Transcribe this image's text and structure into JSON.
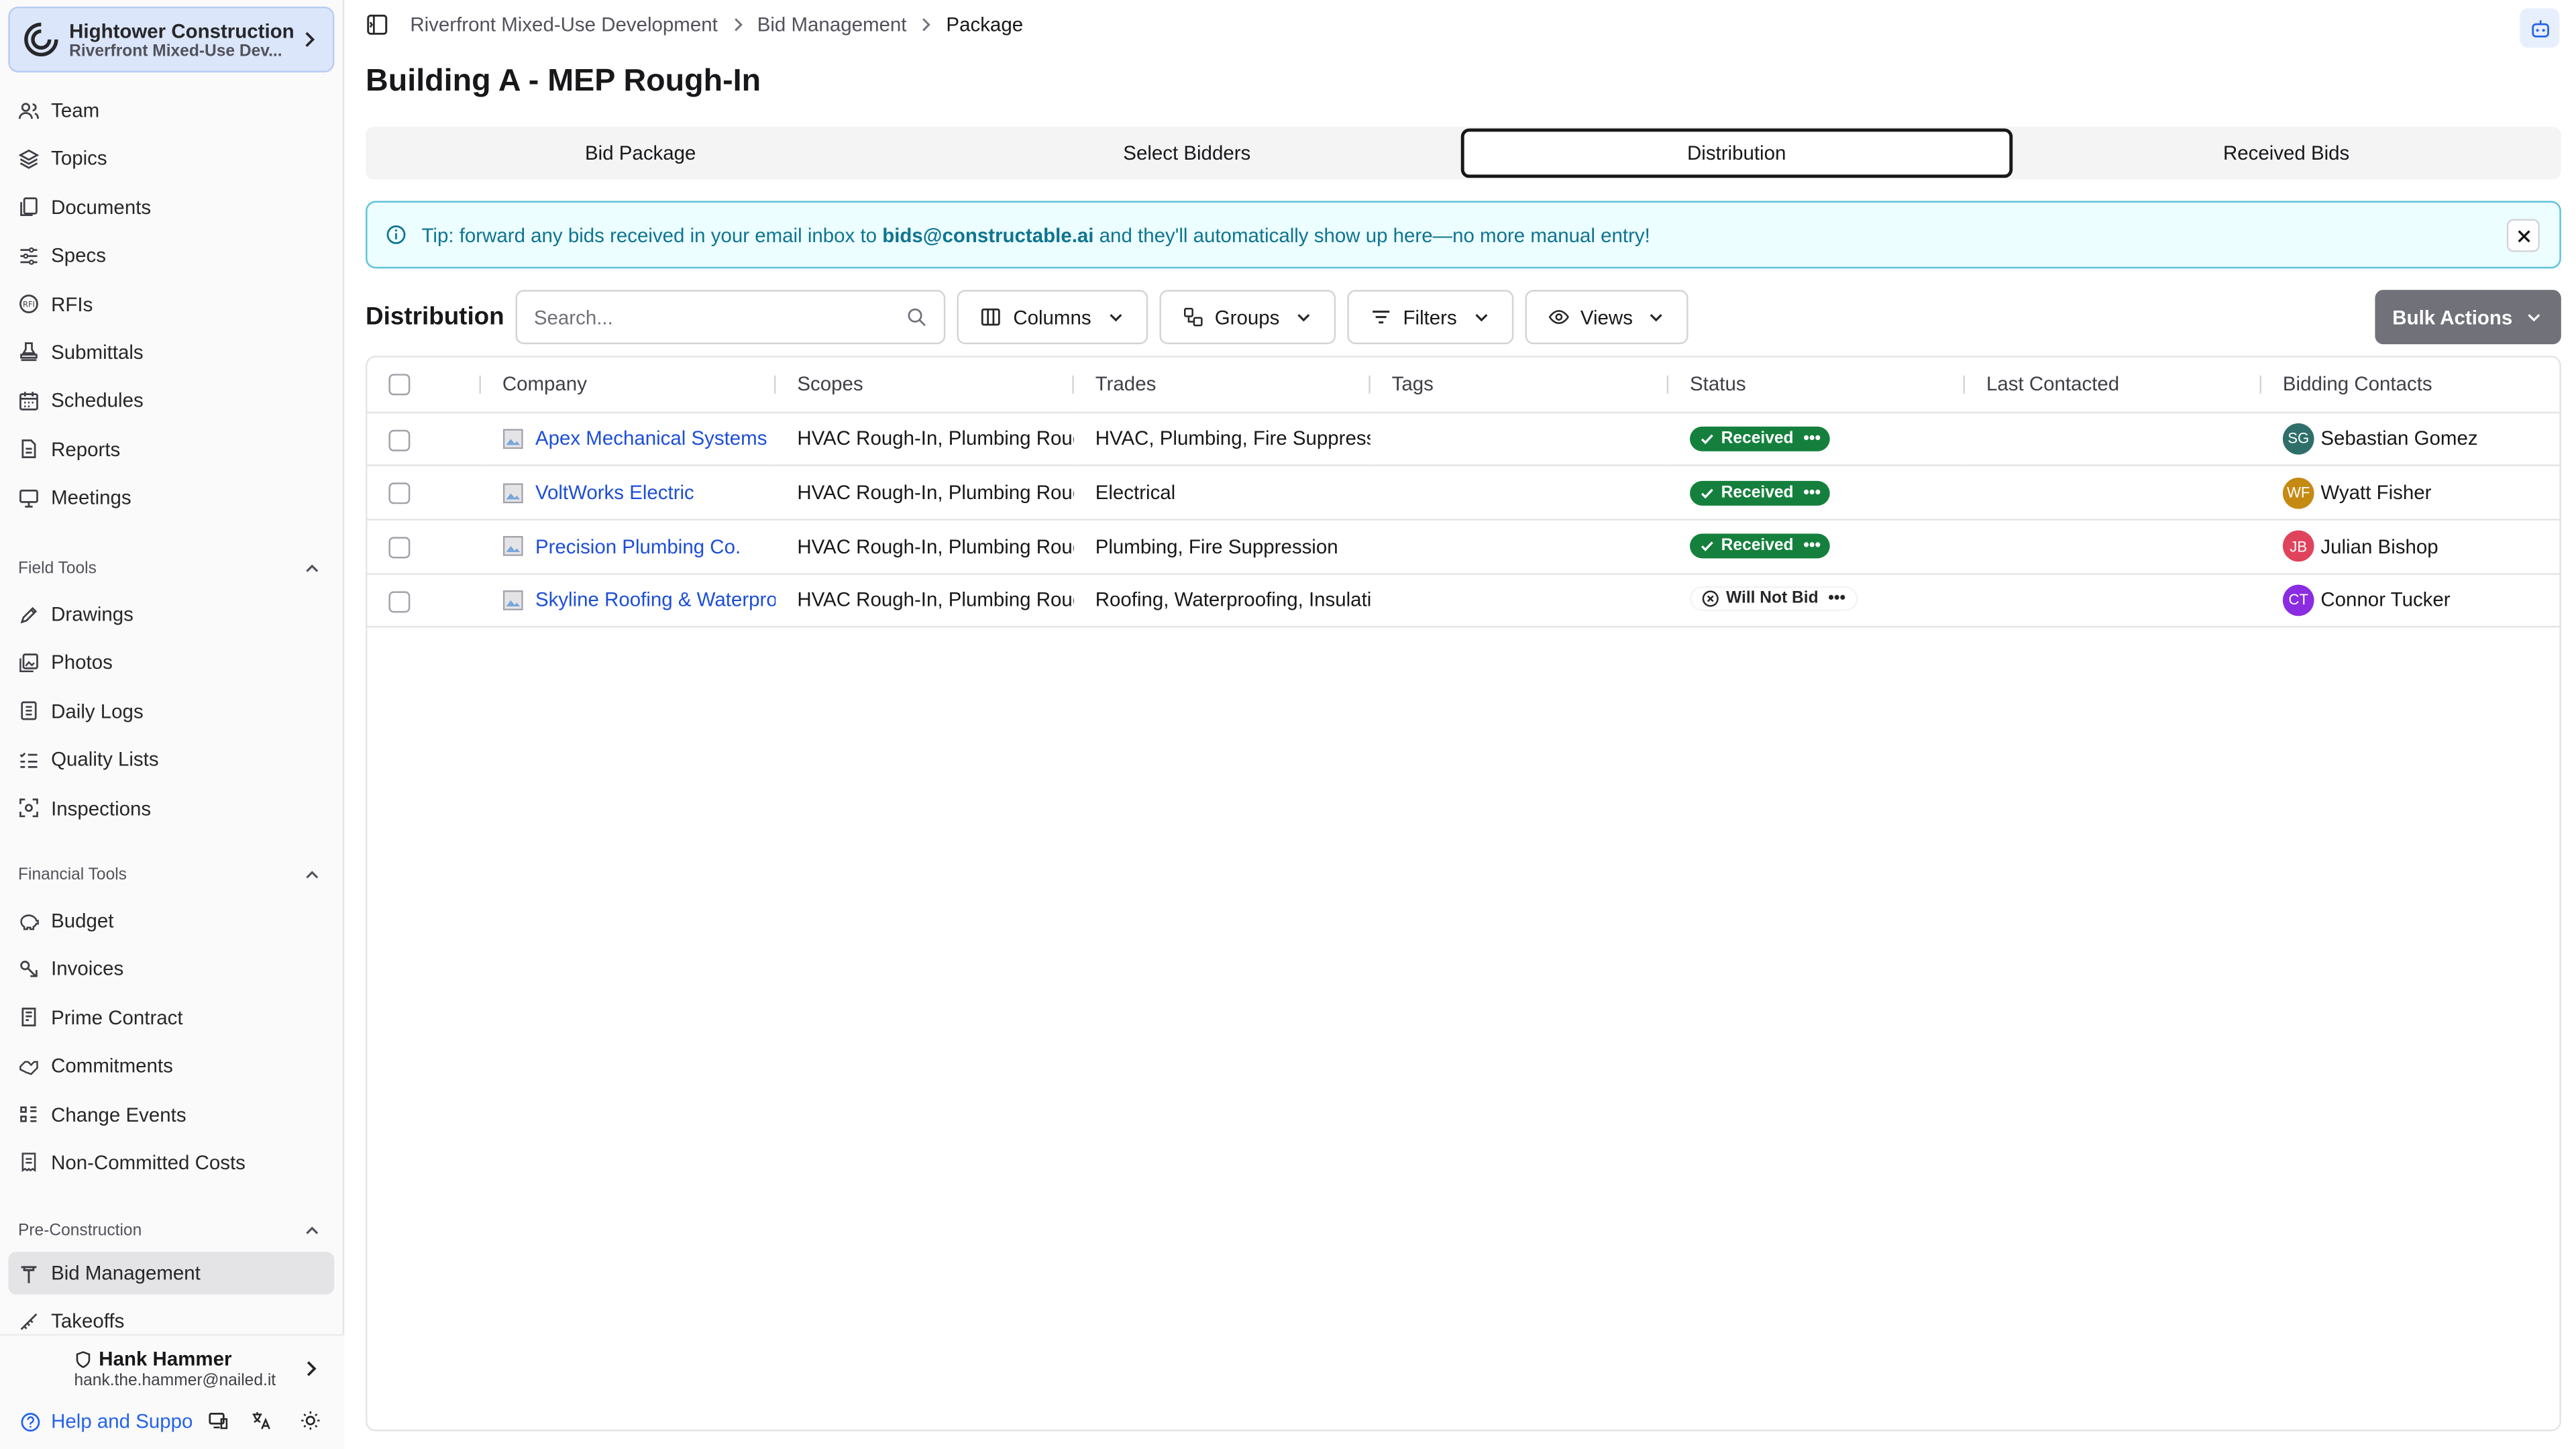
{
  "org": {
    "name": "Hightower Construction",
    "project": "Riverfront Mixed-Use Dev..."
  },
  "nav": {
    "main": [
      {
        "label": "Team",
        "icon": "users-icon"
      },
      {
        "label": "Topics",
        "icon": "layers-icon"
      },
      {
        "label": "Documents",
        "icon": "documents-icon"
      },
      {
        "label": "Specs",
        "icon": "specs-icon"
      },
      {
        "label": "RFIs",
        "icon": "rfi-icon"
      },
      {
        "label": "Submittals",
        "icon": "stamp-icon"
      },
      {
        "label": "Schedules",
        "icon": "calendar-icon"
      },
      {
        "label": "Reports",
        "icon": "report-icon"
      },
      {
        "label": "Meetings",
        "icon": "presentation-icon"
      }
    ],
    "field_tools": {
      "title": "Field Tools",
      "items": [
        {
          "label": "Drawings",
          "icon": "drawing-icon"
        },
        {
          "label": "Photos",
          "icon": "photos-icon"
        },
        {
          "label": "Daily Logs",
          "icon": "notebook-icon"
        },
        {
          "label": "Quality Lists",
          "icon": "checklist-icon"
        },
        {
          "label": "Inspections",
          "icon": "scan-icon"
        }
      ]
    },
    "financial_tools": {
      "title": "Financial Tools",
      "items": [
        {
          "label": "Budget",
          "icon": "piggy-bank-icon"
        },
        {
          "label": "Invoices",
          "icon": "invoice-icon"
        },
        {
          "label": "Prime Contract",
          "icon": "contract-icon"
        },
        {
          "label": "Commitments",
          "icon": "handshake-icon"
        },
        {
          "label": "Change Events",
          "icon": "change-icon"
        },
        {
          "label": "Non-Committed Costs",
          "icon": "receipt-icon"
        }
      ]
    },
    "pre_construction": {
      "title": "Pre-Construction",
      "items": [
        {
          "label": "Bid Management",
          "icon": "gavel-icon",
          "active": true
        },
        {
          "label": "Takeoffs",
          "icon": "ruler-icon"
        }
      ]
    }
  },
  "user": {
    "name": "Hank Hammer",
    "email": "hank.the.hammer@nailed.it"
  },
  "help_label": "Help and Suppo",
  "breadcrumb": [
    "Riverfront Mixed-Use Development",
    "Bid Management",
    "Package"
  ],
  "page_title": "Building A - MEP Rough-In",
  "tabs": [
    "Bid Package",
    "Select Bidders",
    "Distribution",
    "Received Bids"
  ],
  "active_tab": "Distribution",
  "tip": {
    "prefix": "Tip: forward any bids received in your email inbox to ",
    "email": "bids@constructable.ai",
    "suffix": " and they'll automatically show up here—no more manual entry!"
  },
  "toolbar": {
    "title": "Distribution",
    "search_placeholder": "Search...",
    "columns": "Columns",
    "groups": "Groups",
    "filters": "Filters",
    "views": "Views",
    "bulk_actions": "Bulk Actions"
  },
  "table": {
    "headers": [
      "Company",
      "Scopes",
      "Trades",
      "Tags",
      "Status",
      "Last Contacted",
      "Bidding Contacts"
    ],
    "rows": [
      {
        "company": "Apex Mechanical Systems",
        "scopes": "HVAC Rough-In, Plumbing Roug",
        "trades": "HVAC, Plumbing, Fire Suppressi",
        "tags": "",
        "status": "Received",
        "last_contacted": "",
        "contact": "Sebastian Gomez",
        "initials": "SG",
        "avatar_color": "#2f6f6a"
      },
      {
        "company": "VoltWorks Electric",
        "scopes": "HVAC Rough-In, Plumbing Roug",
        "trades": "Electrical",
        "tags": "",
        "status": "Received",
        "last_contacted": "",
        "contact": "Wyatt Fisher",
        "initials": "WF",
        "avatar_color": "#c58a12"
      },
      {
        "company": "Precision Plumbing Co.",
        "scopes": "HVAC Rough-In, Plumbing Roug",
        "trades": "Plumbing, Fire Suppression",
        "tags": "",
        "status": "Received",
        "last_contacted": "",
        "contact": "Julian Bishop",
        "initials": "JB",
        "avatar_color": "#e0445c"
      },
      {
        "company": "Skyline Roofing & Waterpro",
        "scopes": "HVAC Rough-In, Plumbing Roug",
        "trades": "Roofing, Waterproofing, Insulati",
        "tags": "",
        "status": "Will Not Bid",
        "last_contacted": "",
        "contact": "Connor Tucker",
        "initials": "CT",
        "avatar_color": "#8b2be2"
      }
    ]
  },
  "colors": {
    "accent": "#2563eb",
    "received": "#15803d",
    "tip_bg": "#ecfeff",
    "tip_text": "#0e7490"
  }
}
